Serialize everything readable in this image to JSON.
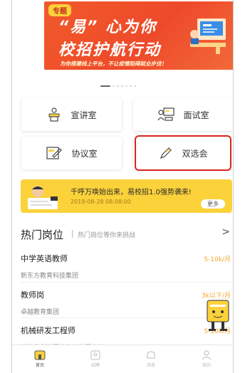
{
  "banner": {
    "tag": "专题",
    "line1": "“易” 心为你",
    "line2": "校招护航行动",
    "subtitle": "为你搭建线上平台，不让疫情阻碍就业步伐！"
  },
  "grid": {
    "items": [
      {
        "label": "宣讲室",
        "icon": "podium-icon"
      },
      {
        "label": "面试室",
        "icon": "meeting-icon"
      },
      {
        "label": "协议室",
        "icon": "contract-icon"
      },
      {
        "label": "双选会",
        "icon": "pen-icon"
      }
    ]
  },
  "notice": {
    "title": "千呼万唤始出来，易校招1.0强势袭来!",
    "date": "2019-08-28 08:08:00",
    "more": "更多"
  },
  "hot": {
    "title": "热门岗位",
    "subtitle": "热门岗位等你来挑战",
    "arrow": ">",
    "jobs": [
      {
        "title": "中学英语教师",
        "company": "新东方教育科技集团",
        "salary": "5-10k/月"
      },
      {
        "title": "教师岗",
        "company": "卓越教育集团",
        "salary": "3k以下/月"
      },
      {
        "title": "机械研发工程师",
        "company": "桂林优利特医疗电子有限公司",
        "salary": "5-10k/月"
      }
    ]
  },
  "tabbar": {
    "items": [
      {
        "label": "首页",
        "icon": "home-icon",
        "active": true
      },
      {
        "label": "招聘",
        "icon": "resume-icon",
        "active": false
      },
      {
        "label": "消息",
        "icon": "bell-icon",
        "active": false
      },
      {
        "label": "我的",
        "icon": "user-icon",
        "active": false
      }
    ]
  },
  "colors": {
    "brand_yellow": "#fcd23b",
    "banner_red": "#ee4a2a",
    "salary_orange": "#f3a72d",
    "highlight_red": "#d9241c"
  }
}
